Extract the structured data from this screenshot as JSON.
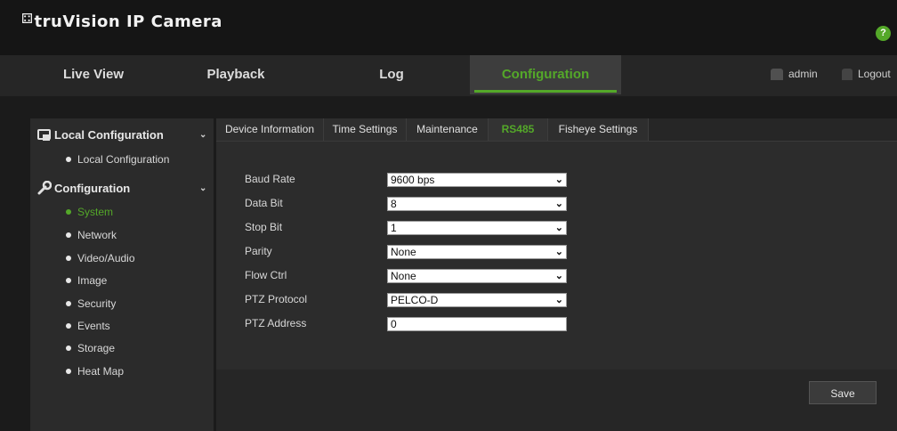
{
  "app": {
    "brand_mark": "⚃",
    "title": "truVision  IP Camera",
    "help": "?"
  },
  "nav": {
    "tabs": [
      {
        "label": "Live View"
      },
      {
        "label": "Playback"
      },
      {
        "label": "Log"
      },
      {
        "label": "Configuration"
      }
    ],
    "user": "admin",
    "logout": "Logout"
  },
  "sidebar": {
    "local": {
      "title": "Local Configuration",
      "items": [
        {
          "label": "Local Configuration"
        }
      ]
    },
    "config": {
      "title": "Configuration",
      "items": [
        {
          "label": "System"
        },
        {
          "label": "Network"
        },
        {
          "label": "Video/Audio"
        },
        {
          "label": "Image"
        },
        {
          "label": "Security"
        },
        {
          "label": "Events"
        },
        {
          "label": "Storage"
        },
        {
          "label": "Heat Map"
        }
      ]
    }
  },
  "subtabs": [
    {
      "label": "Device Information"
    },
    {
      "label": "Time Settings"
    },
    {
      "label": "Maintenance"
    },
    {
      "label": "RS485"
    },
    {
      "label": "Fisheye Settings"
    }
  ],
  "form": {
    "baud_rate": {
      "label": "Baud Rate",
      "value": "9600 bps"
    },
    "data_bit": {
      "label": "Data Bit",
      "value": "8"
    },
    "stop_bit": {
      "label": "Stop Bit",
      "value": "1"
    },
    "parity": {
      "label": "Parity",
      "value": "None"
    },
    "flow_ctrl": {
      "label": "Flow Ctrl",
      "value": "None"
    },
    "ptz_protocol": {
      "label": "PTZ Protocol",
      "value": "PELCO-D"
    },
    "ptz_address": {
      "label": "PTZ Address",
      "value": "0"
    }
  },
  "save_label": "Save",
  "colors": {
    "accent": "#54a829",
    "background": "#1b1b1b",
    "panel": "#2c2c2c"
  }
}
